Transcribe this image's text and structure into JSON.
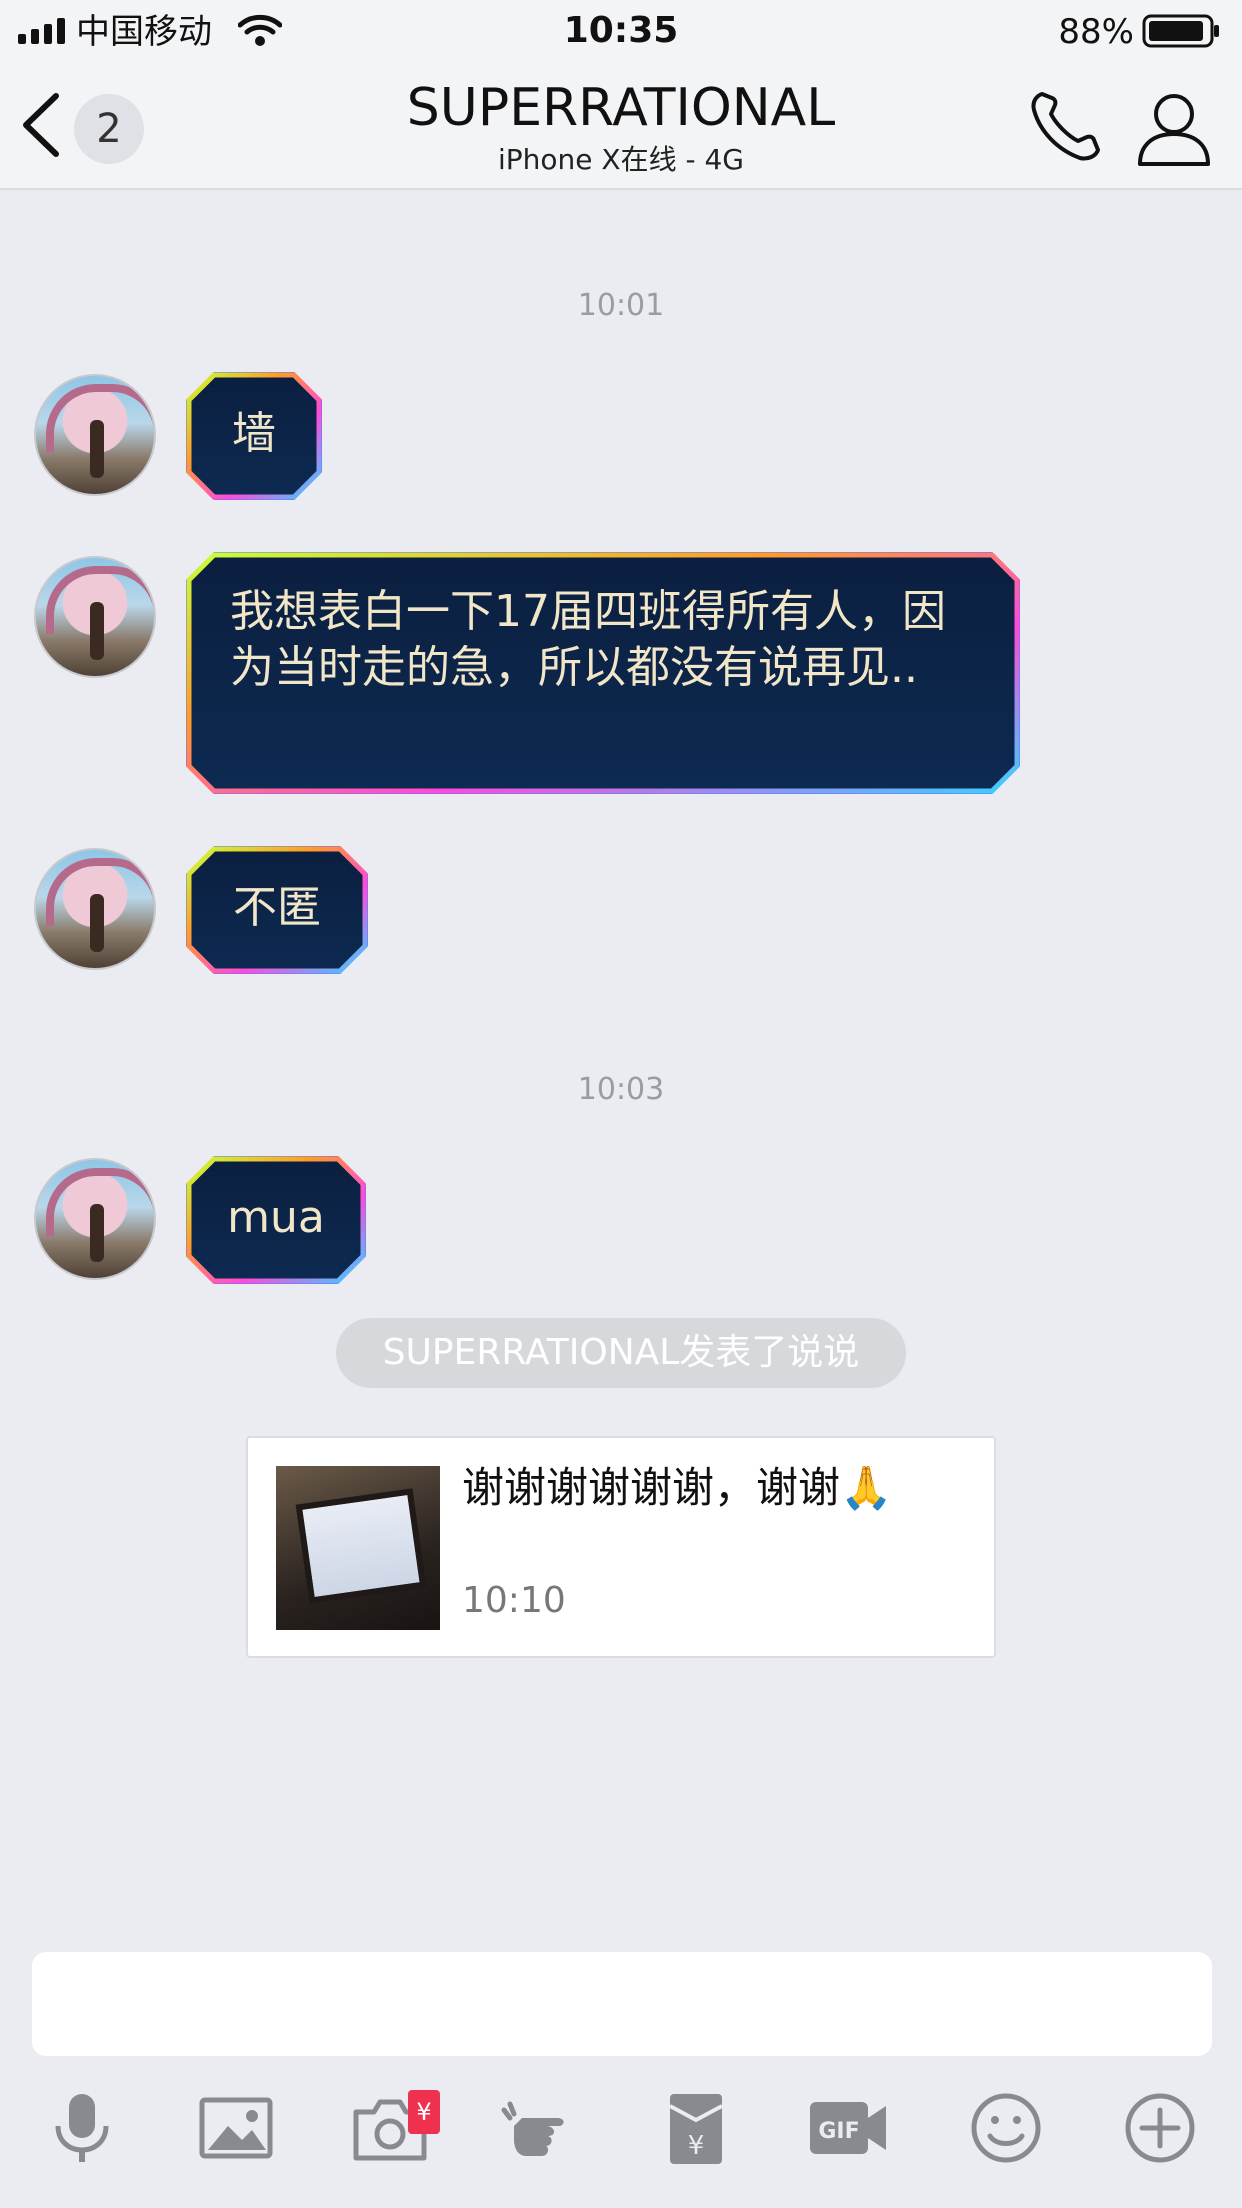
{
  "status_bar": {
    "carrier": "中国移动",
    "time": "10:35",
    "battery_pct": "88%"
  },
  "nav": {
    "back_badge": "2",
    "title": "SUPERRATIONAL",
    "subtitle": "iPhone X在线 - 4G"
  },
  "chat": {
    "timestamps": [
      "10:01",
      "10:03"
    ],
    "messages": [
      {
        "text": "墙"
      },
      {
        "text": "我想表白一下17届四班得所有人，因为当时走的急，所以都没有说再见.."
      },
      {
        "text": "不匿"
      },
      {
        "text": "mua"
      }
    ],
    "system_notice": "SUPERRATIONAL发表了说说",
    "post_card": {
      "text": "谢谢谢谢谢谢，谢谢🙏",
      "time": "10:10"
    }
  },
  "toolbar": {
    "icons": [
      "microphone-icon",
      "image-icon",
      "camera-icon",
      "poke-icon",
      "red-packet-icon",
      "gif-icon",
      "emoji-icon",
      "plus-icon"
    ],
    "camera_badge": "¥"
  },
  "colors": {
    "background": "#eaecf1",
    "bubble_bg": "#0b1f3f",
    "bubble_text": "#f2e6c9",
    "icon_gray": "#888a90"
  }
}
